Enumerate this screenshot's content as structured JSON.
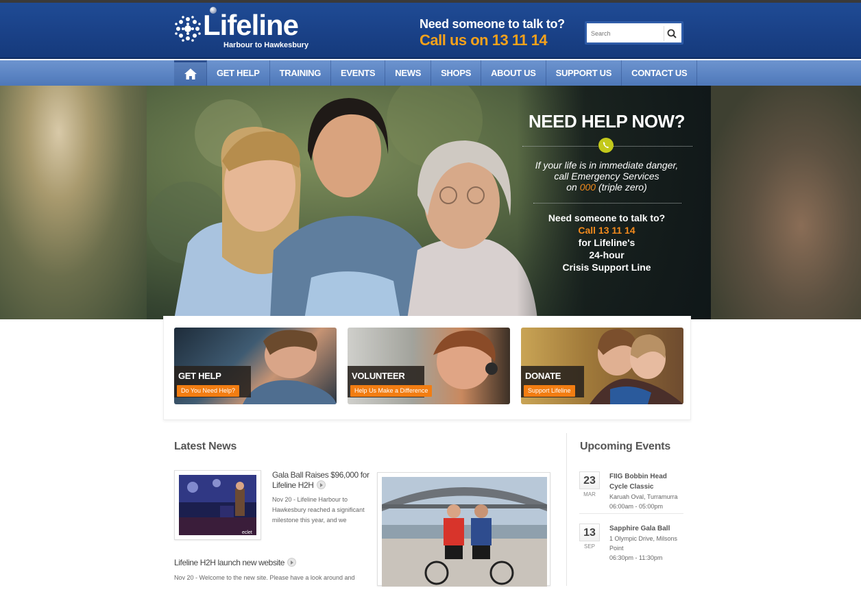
{
  "header": {
    "logo_word": "Lifeline",
    "logo_sub": "Harbour to Hawkesbury",
    "hotline_question": "Need someone to talk to?",
    "hotline_call": "Call us on 13 11 14",
    "search_placeholder": "Search"
  },
  "nav": {
    "items": [
      "GET HELP",
      "TRAINING",
      "EVENTS",
      "NEWS",
      "SHOPS",
      "ABOUT US",
      "SUPPORT US",
      "CONTACT US"
    ]
  },
  "hero": {
    "title": "NEED HELP NOW?",
    "danger_line1": "If your life is in immediate danger,",
    "danger_line2": "call Emergency Services",
    "danger_on": "on",
    "danger_number": "000",
    "danger_suffix": "(triple zero)",
    "talk_line1": "Need someone to talk to?",
    "talk_call": "Call 13 11 14",
    "talk_line3": "for Lifeline's",
    "talk_line4": "24-hour",
    "talk_line5": "Crisis Support Line"
  },
  "features": [
    {
      "title": "GET HELP",
      "button": "Do You Need Help?"
    },
    {
      "title": "VOLUNTEER",
      "button": "Help Us Make a Difference"
    },
    {
      "title": "DONATE",
      "button": "Support Lifeline"
    }
  ],
  "latest_news": {
    "title": "Latest News",
    "items": [
      {
        "headline": "Gala Ball Raises $96,000 for Lifeline H2H",
        "body": "Nov 20 - Lifeline Harbour to Hawkesbury reached a significant milestone this year, and we"
      },
      {
        "headline": "Lifeline H2H launch new website",
        "body": "Nov 20 - Welcome to the new site.  Please have a look around and"
      }
    ]
  },
  "upcoming_events": {
    "title": "Upcoming Events",
    "items": [
      {
        "day": "23",
        "month": "MAR",
        "title": "FIIG Bobbin Head Cycle Classic",
        "location": "Karuah Oval, Turramurra",
        "time": "06:00am - 05:00pm"
      },
      {
        "day": "13",
        "month": "SEP",
        "title": "Sapphire Gala Ball",
        "location": "1 Olympic Drive, Milsons Point",
        "time": "06:30pm - 11:30pm"
      }
    ]
  },
  "colors": {
    "header_blue": "#1a4187",
    "nav_blue": "#5a83c2",
    "accent_orange": "#f6a21b",
    "button_orange": "#f27d12",
    "phone_green": "#c3c91b"
  }
}
